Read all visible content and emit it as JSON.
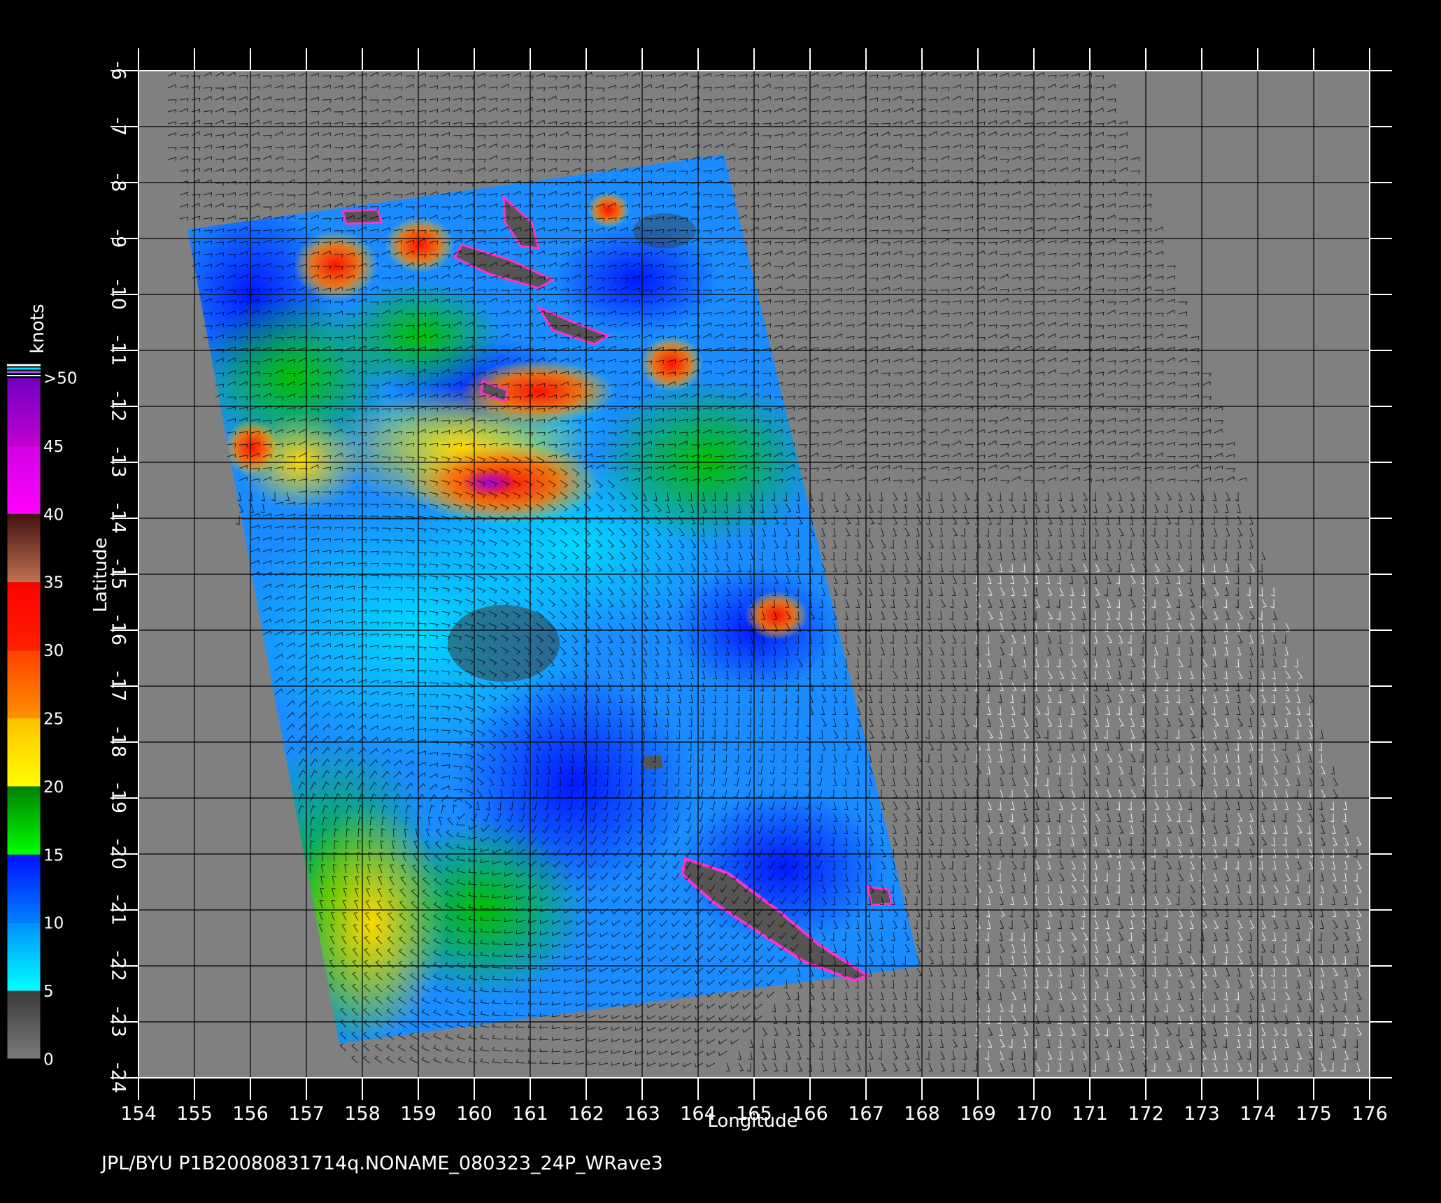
{
  "map": {
    "xlabel": "Longitude",
    "ylabel": "Latitude",
    "lon_range": [
      154,
      176
    ],
    "lat_range": [
      -24,
      -6
    ],
    "lon_ticks": [
      "154",
      "155",
      "156",
      "157",
      "158",
      "159",
      "160",
      "161",
      "162",
      "163",
      "164",
      "165",
      "166",
      "167",
      "168",
      "169",
      "170",
      "171",
      "172",
      "173",
      "174",
      "175",
      "176"
    ],
    "lat_ticks": [
      "-6",
      "-7",
      "-8",
      "-9",
      "-10",
      "-11",
      "-12",
      "-13",
      "-14",
      "-15",
      "-16",
      "-17",
      "-18",
      "-19",
      "-20",
      "-21",
      "-22",
      "-23",
      "-24"
    ],
    "grid": true,
    "background_color": "#808080",
    "land_color": "#555555",
    "wind_barb_color": "#000000",
    "flagged_barb_color": "#ffffff"
  },
  "colorbar": {
    "unit": "knots",
    "labels": [
      "0",
      "5",
      "10",
      "15",
      "20",
      "25",
      "30",
      "35",
      "40",
      "45",
      ">50"
    ],
    "bands": [
      {
        "from": 0,
        "to": 5,
        "colors": [
          "#7a7a7a",
          "#3a3a3a"
        ]
      },
      {
        "from": 5,
        "to": 10,
        "colors": [
          "#00ffff",
          "#0090ff"
        ]
      },
      {
        "from": 10,
        "to": 15,
        "colors": [
          "#0080ff",
          "#0010ff"
        ]
      },
      {
        "from": 15,
        "to": 20,
        "colors": [
          "#00ff00",
          "#008000"
        ]
      },
      {
        "from": 20,
        "to": 25,
        "colors": [
          "#ffff00",
          "#ffc000"
        ]
      },
      {
        "from": 25,
        "to": 30,
        "colors": [
          "#ff9000",
          "#ff4000"
        ]
      },
      {
        "from": 30,
        "to": 35,
        "colors": [
          "#ff2000",
          "#ff0000"
        ]
      },
      {
        "from": 35,
        "to": 40,
        "colors": [
          "#c07050",
          "#401010"
        ]
      },
      {
        "from": 40,
        "to": 45,
        "colors": [
          "#ff00ff",
          "#d000e0"
        ]
      },
      {
        "from": 45,
        "to": 50,
        "colors": [
          "#c000d0",
          "#7000c0"
        ]
      }
    ]
  },
  "footer": {
    "caption": "JPL/BYU  P1B20080831714q.NONAME_080323_24P_WRave3"
  }
}
